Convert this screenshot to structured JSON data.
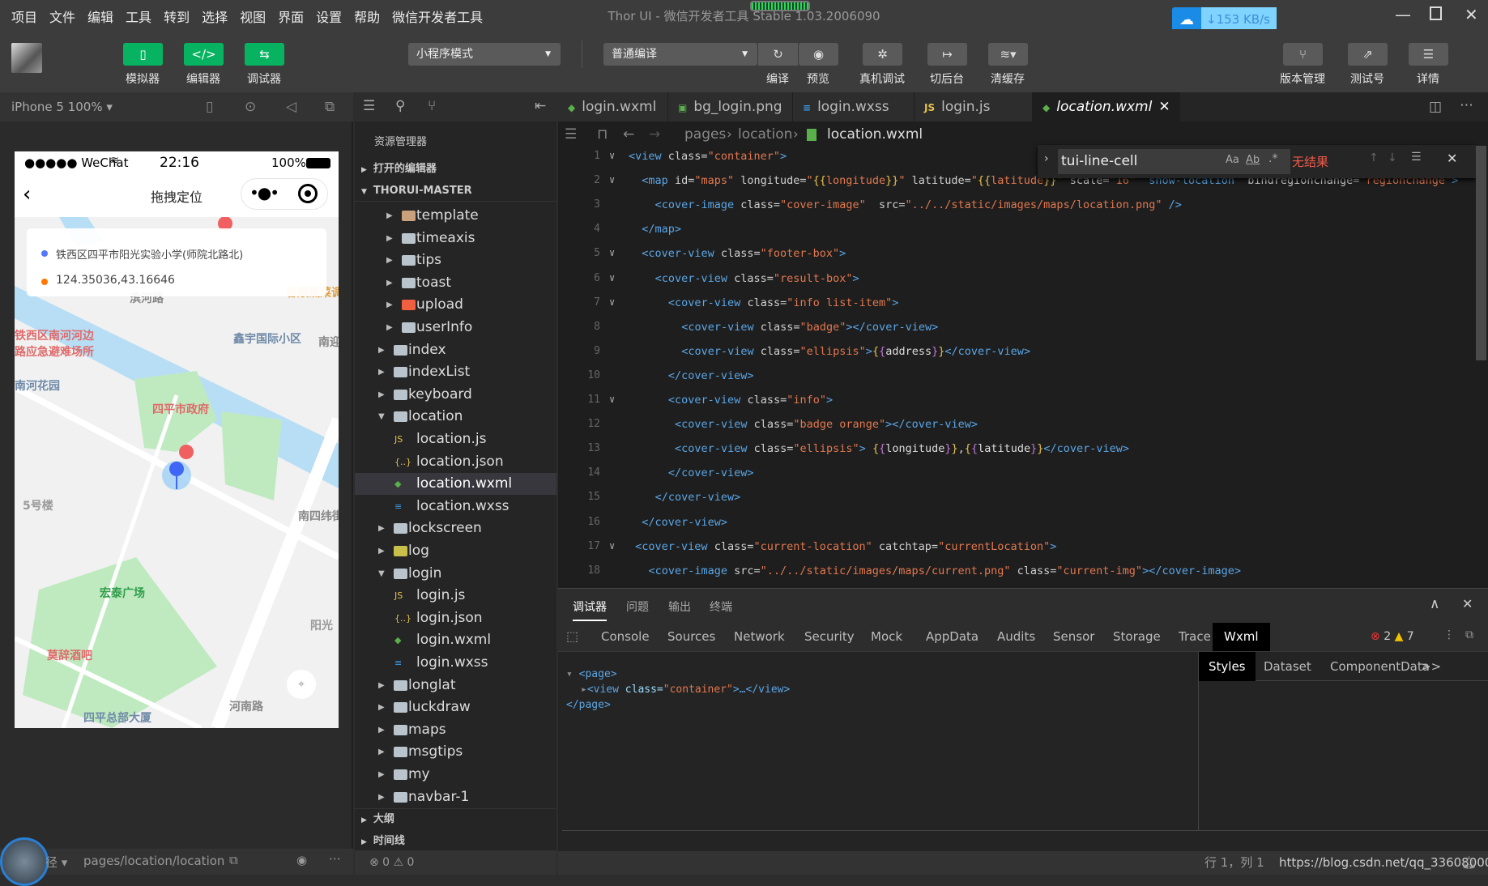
{
  "menubar": {
    "items": [
      "项目",
      "文件",
      "编辑",
      "工具",
      "转到",
      "选择",
      "视图",
      "界面",
      "设置",
      "帮助",
      "微信开发者工具"
    ],
    "title": "Thor UI - 微信开发者工具 Stable 1.03.2006090",
    "network_speed": "↓153 KB/s"
  },
  "toolbar": {
    "simulator": "模拟器",
    "editor": "编辑器",
    "debugger": "调试器",
    "mode": "小程序模式",
    "compile_mode": "普通编译",
    "compile": "编译",
    "preview": "预览",
    "remote_debug": "真机调试",
    "background": "切后台",
    "clear_cache": "清缓存",
    "version": "版本管理",
    "test_account": "测试号",
    "details": "详情"
  },
  "simulator": {
    "device": "iPhone 5 100% ▾",
    "carrier": "●●●●● WeChat",
    "time": "22:16",
    "battery": "100%",
    "nav_title": "拖拽定位",
    "address": "铁西区四平市阳光实验小学(师院北路北)",
    "coords": "124.35036,43.16646",
    "address_dot_color": "#5677fc",
    "coords_dot_color": "#ff7900",
    "map_labels": [
      "铁西区南河河边",
      "路应急避难场所",
      "鑫宇国际小区",
      "滨河路",
      "南河花园",
      "南迎宾街",
      "四平市政府",
      "5号楼",
      "宏泰广场",
      "南四纬街",
      "莫辞酒吧",
      "四平总部大厦",
      "河南路",
      "阳光",
      "春顺蔬菜调"
    ],
    "footer_path": "pages/location/location",
    "footer_prefix": "径 ▾"
  },
  "explorer": {
    "title": "资源管理器",
    "open_editors": "打开的编辑器",
    "project": "THORUI-MASTER",
    "outline": "大纲",
    "timeline": "时间线",
    "problems": "⊗ 0 ⚠ 0",
    "items": [
      {
        "label": "template",
        "type": "folder-img",
        "depth": 2,
        "open": false
      },
      {
        "label": "timeaxis",
        "type": "folder",
        "depth": 2,
        "open": false
      },
      {
        "label": "tips",
        "type": "folder",
        "depth": 2,
        "open": false
      },
      {
        "label": "toast",
        "type": "folder",
        "depth": 2,
        "open": false
      },
      {
        "label": "upload",
        "type": "folder-red",
        "depth": 2,
        "open": false
      },
      {
        "label": "userInfo",
        "type": "folder",
        "depth": 2,
        "open": false
      },
      {
        "label": "index",
        "type": "folder",
        "depth": 1,
        "open": false
      },
      {
        "label": "indexList",
        "type": "folder",
        "depth": 1,
        "open": false
      },
      {
        "label": "keyboard",
        "type": "folder",
        "depth": 1,
        "open": false
      },
      {
        "label": "location",
        "type": "folder",
        "depth": 1,
        "open": true
      },
      {
        "label": "location.js",
        "type": "js",
        "depth": 2
      },
      {
        "label": "location.json",
        "type": "json",
        "depth": 2
      },
      {
        "label": "location.wxml",
        "type": "wxml",
        "depth": 2,
        "selected": true
      },
      {
        "label": "location.wxss",
        "type": "wxss",
        "depth": 2
      },
      {
        "label": "lockscreen",
        "type": "folder",
        "depth": 1,
        "open": false
      },
      {
        "label": "log",
        "type": "folder-log",
        "depth": 1,
        "open": false
      },
      {
        "label": "login",
        "type": "folder",
        "depth": 1,
        "open": true
      },
      {
        "label": "login.js",
        "type": "js",
        "depth": 2
      },
      {
        "label": "login.json",
        "type": "json",
        "depth": 2
      },
      {
        "label": "login.wxml",
        "type": "wxml",
        "depth": 2
      },
      {
        "label": "login.wxss",
        "type": "wxss",
        "depth": 2
      },
      {
        "label": "longlat",
        "type": "folder",
        "depth": 1,
        "open": false
      },
      {
        "label": "luckdraw",
        "type": "folder",
        "depth": 1,
        "open": false
      },
      {
        "label": "maps",
        "type": "folder",
        "depth": 1,
        "open": false
      },
      {
        "label": "msgtips",
        "type": "folder",
        "depth": 1,
        "open": false
      },
      {
        "label": "my",
        "type": "folder",
        "depth": 1,
        "open": false
      },
      {
        "label": "navbar-1",
        "type": "folder",
        "depth": 1,
        "open": false
      }
    ]
  },
  "editor": {
    "tabs": [
      {
        "label": "login.wxml",
        "icon": "wxml"
      },
      {
        "label": "bg_login.png",
        "icon": "image"
      },
      {
        "label": "login.wxss",
        "icon": "wxss"
      },
      {
        "label": "login.js",
        "icon": "js"
      },
      {
        "label": "location.wxml",
        "icon": "wxml",
        "active": true
      }
    ],
    "breadcrumb": [
      "pages",
      "location",
      "location.wxml"
    ],
    "find": {
      "query": "tui-line-cell",
      "result": "无结果"
    },
    "lines": [
      {
        "n": 1,
        "fold": true,
        "indent": 0,
        "tokens": [
          [
            "tg",
            "<view "
          ],
          [
            "at",
            "class="
          ],
          [
            "st",
            "\"container\""
          ],
          [
            "tg",
            ">"
          ]
        ]
      },
      {
        "n": 2,
        "fold": true,
        "indent": 2,
        "tokens": [
          [
            "tg",
            "<map "
          ],
          [
            "at",
            "id="
          ],
          [
            "st",
            "\"maps\""
          ],
          [
            "at",
            " longitude="
          ],
          [
            "st",
            "\""
          ],
          [
            "mu",
            "{{"
          ],
          [
            "st",
            "longitude"
          ],
          [
            "mu",
            "}}"
          ],
          [
            "st",
            "\""
          ],
          [
            "at",
            " latitude="
          ],
          [
            "st",
            "\""
          ],
          [
            "mu",
            "{{"
          ],
          [
            "st",
            "latitude"
          ],
          [
            "mu",
            "}}"
          ],
          [
            "st",
            "\""
          ],
          [
            "at",
            " scale="
          ],
          [
            "st",
            "\"16\""
          ],
          [
            "tg",
            "  show-location"
          ],
          [
            "at",
            "  bindregionchange="
          ],
          [
            "st",
            "\"regionchange\""
          ],
          [
            "tg",
            ">"
          ]
        ]
      },
      {
        "n": 3,
        "fold": false,
        "indent": 4,
        "tokens": [
          [
            "tg",
            "<cover-image "
          ],
          [
            "at",
            "class="
          ],
          [
            "st",
            "\"cover-image\""
          ],
          [
            "at",
            "  src="
          ],
          [
            "st",
            "\"../../static/images/maps/location.png\""
          ],
          [
            "tg",
            " />"
          ]
        ]
      },
      {
        "n": 4,
        "fold": false,
        "indent": 2,
        "tokens": [
          [
            "tg",
            "</map>"
          ]
        ]
      },
      {
        "n": 5,
        "fold": true,
        "indent": 2,
        "tokens": [
          [
            "tg",
            "<cover-view "
          ],
          [
            "at",
            "class="
          ],
          [
            "st",
            "\"footer-box\""
          ],
          [
            "tg",
            ">"
          ]
        ]
      },
      {
        "n": 6,
        "fold": true,
        "indent": 4,
        "tokens": [
          [
            "tg",
            "<cover-view "
          ],
          [
            "at",
            "class="
          ],
          [
            "st",
            "\"result-box\""
          ],
          [
            "tg",
            ">"
          ]
        ]
      },
      {
        "n": 7,
        "fold": true,
        "indent": 6,
        "tokens": [
          [
            "tg",
            "<cover-view "
          ],
          [
            "at",
            "class="
          ],
          [
            "st",
            "\"info list-item\""
          ],
          [
            "tg",
            ">"
          ]
        ]
      },
      {
        "n": 8,
        "fold": false,
        "indent": 8,
        "tokens": [
          [
            "tg",
            "<cover-view "
          ],
          [
            "at",
            "class="
          ],
          [
            "st",
            "\"badge\""
          ],
          [
            "tg",
            "></cover-view>"
          ]
        ]
      },
      {
        "n": 9,
        "fold": false,
        "indent": 8,
        "tokens": [
          [
            "tg",
            "<cover-view "
          ],
          [
            "at",
            "class="
          ],
          [
            "st",
            "\"ellipsis\""
          ],
          [
            "tg",
            ">"
          ],
          [
            "mu",
            "{"
          ],
          [
            "mp",
            "{"
          ],
          [
            "vr",
            "address"
          ],
          [
            "mp",
            "}"
          ],
          [
            "mu",
            "}"
          ],
          [
            "tg",
            "</cover-view>"
          ]
        ]
      },
      {
        "n": 10,
        "fold": false,
        "indent": 6,
        "tokens": [
          [
            "tg",
            "</cover-view>"
          ]
        ]
      },
      {
        "n": 11,
        "fold": true,
        "indent": 6,
        "tokens": [
          [
            "tg",
            "<cover-view "
          ],
          [
            "at",
            "class="
          ],
          [
            "st",
            "\"info\""
          ],
          [
            "tg",
            ">"
          ]
        ]
      },
      {
        "n": 12,
        "fold": false,
        "indent": 7,
        "tokens": [
          [
            "tg",
            "<cover-view "
          ],
          [
            "at",
            "class="
          ],
          [
            "st",
            "\"badge orange\""
          ],
          [
            "tg",
            "></cover-view>"
          ]
        ]
      },
      {
        "n": 13,
        "fold": false,
        "indent": 7,
        "tokens": [
          [
            "tg",
            "<cover-view "
          ],
          [
            "at",
            "class="
          ],
          [
            "st",
            "\"ellipsis\""
          ],
          [
            "tg",
            ">"
          ],
          [
            "vr",
            " "
          ],
          [
            "mu",
            "{"
          ],
          [
            "mp",
            "{"
          ],
          [
            "vr",
            "longitude"
          ],
          [
            "mp",
            "}"
          ],
          [
            "mu",
            "}"
          ],
          [
            "vr",
            ","
          ],
          [
            "mu",
            "{"
          ],
          [
            "mp",
            "{"
          ],
          [
            "vr",
            "latitude"
          ],
          [
            "mp",
            "}"
          ],
          [
            "mu",
            "}"
          ],
          [
            "tg",
            "</cover-view>"
          ]
        ]
      },
      {
        "n": 14,
        "fold": false,
        "indent": 6,
        "tokens": [
          [
            "tg",
            "</cover-view>"
          ]
        ]
      },
      {
        "n": 15,
        "fold": false,
        "indent": 4,
        "tokens": [
          [
            "tg",
            "</cover-view>"
          ]
        ]
      },
      {
        "n": 16,
        "fold": false,
        "indent": 2,
        "tokens": [
          [
            "tg",
            "</cover-view>"
          ]
        ]
      },
      {
        "n": 17,
        "fold": true,
        "indent": 1,
        "tokens": [
          [
            "tg",
            "<cover-view "
          ],
          [
            "at",
            "class="
          ],
          [
            "st",
            "\"current-location\""
          ],
          [
            "at",
            " catchtap="
          ],
          [
            "st",
            "\"currentLocation\""
          ],
          [
            "tg",
            ">"
          ]
        ]
      },
      {
        "n": 18,
        "fold": false,
        "indent": 3,
        "tokens": [
          [
            "tg",
            "<cover-image "
          ],
          [
            "at",
            "src="
          ],
          [
            "st",
            "\"../../static/images/maps/current.png\""
          ],
          [
            "at",
            " class="
          ],
          [
            "st",
            "\"current-img\""
          ],
          [
            "tg",
            "></cover-image>"
          ]
        ]
      }
    ]
  },
  "devtools": {
    "panel_tabs": [
      "调试器",
      "问题",
      "输出",
      "终端"
    ],
    "tabs": [
      "Console",
      "Sources",
      "Network",
      "Security",
      "Mock",
      "AppData",
      "Audits",
      "Sensor",
      "Storage",
      "Trace",
      "Wxml"
    ],
    "active_tab": "Wxml",
    "errors": "2",
    "warnings": "7",
    "tree": {
      "open": "<page>",
      "child_tag": "<view ",
      "child_attr": "class=",
      "child_val": "\"container\"",
      "child_rest": ">…</view>",
      "close": "</page>"
    },
    "side_tabs": [
      "Styles",
      "Dataset",
      "ComponentData",
      ">>"
    ]
  },
  "statusbar": {
    "position": "行 1，列 1",
    "watermark": "https://blog.csdn.net/qq_33608000"
  }
}
